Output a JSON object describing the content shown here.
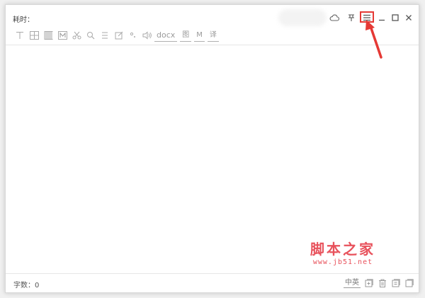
{
  "header": {
    "elapsed_label": "耗时："
  },
  "window_controls": {
    "cloud_icon": "cloud-icon",
    "pin_icon": "pin-icon",
    "menu_icon": "menu-icon",
    "minimize_icon": "minimize-icon",
    "maximize_icon": "maximize-icon",
    "close_icon": "close-icon"
  },
  "toolbar": {
    "docx_label": "docx",
    "image_label": "图",
    "m_label": "M",
    "translate_label": "译"
  },
  "status": {
    "word_count_label": "字数：0",
    "lang_toggle": "中英"
  },
  "watermark": {
    "title": "脚本之家",
    "url": "www.jb51.net"
  },
  "colors": {
    "highlight": "#e53935",
    "watermark": "#e8525c",
    "icon_gray": "#b0b0b0"
  }
}
